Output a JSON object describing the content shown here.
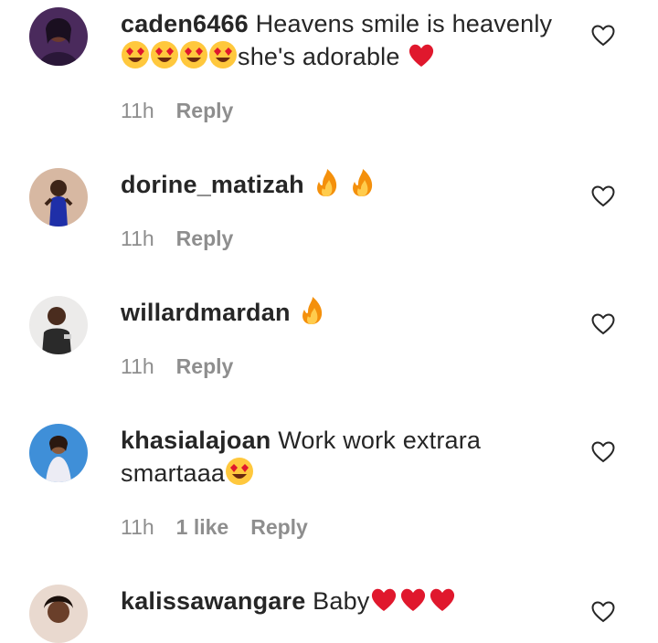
{
  "comments": [
    {
      "username": "caden6466",
      "text_a": "Heavens smile is heavenly",
      "emojis_a": [
        "heart-eyes",
        "heart-eyes",
        "heart-eyes",
        "heart-eyes"
      ],
      "text_b": "she's adorable",
      "emojis_b": [
        "red-heart"
      ],
      "time": "11h",
      "likes": "",
      "reply_label": "Reply"
    },
    {
      "username": "dorine_matizah",
      "emojis_a": [
        "fire",
        "fire"
      ],
      "time": "11h",
      "likes": "",
      "reply_label": "Reply"
    },
    {
      "username": "willardmardan",
      "emojis_a": [
        "fire"
      ],
      "time": "11h",
      "likes": "",
      "reply_label": "Reply"
    },
    {
      "username": "khasialajoan",
      "text_a": "Work work extrara",
      "text_b": "smartaaa",
      "emojis_b": [
        "heart-eyes"
      ],
      "time": "11h",
      "likes": "1 like",
      "reply_label": "Reply"
    },
    {
      "username": "kalissawangare",
      "text_a": "Baby",
      "emojis_a": [
        "red-heart",
        "red-heart",
        "red-heart"
      ],
      "time": "",
      "likes": "",
      "reply_label": ""
    }
  ],
  "icons": {
    "like": "heart-outline-icon",
    "heart_eyes": "heart-eyes-emoji",
    "fire": "fire-emoji",
    "red_heart": "red-heart-emoji"
  },
  "colors": {
    "text": "#262626",
    "meta": "#8e8e8e",
    "heart_red": "#e0182d",
    "emoji_yellow": "#ffc83d"
  }
}
